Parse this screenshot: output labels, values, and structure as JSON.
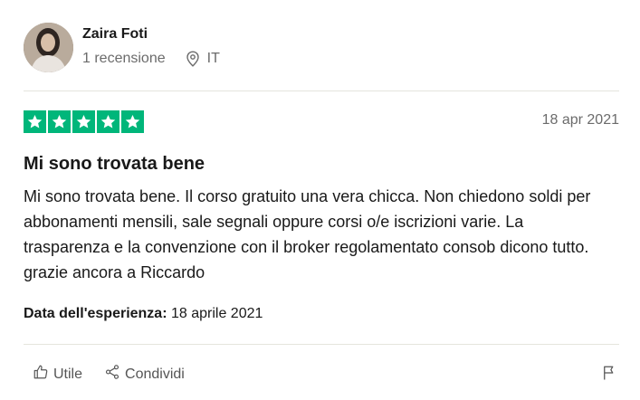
{
  "reviewer": {
    "name": "Zaira Foti",
    "reviews_count": "1 recensione",
    "country": "IT"
  },
  "review": {
    "rating": 5,
    "rating_color": "#00b67a",
    "date": "18 apr 2021",
    "title": "Mi sono trovata bene",
    "body": "Mi sono trovata bene. Il corso gratuito una vera chicca. Non chiedono soldi per abbonamenti mensili, sale segnali oppure corsi o/e iscrizioni varie. La trasparenza e la convenzione con il broker regolamentato consob dicono tutto. grazie ancora a Riccardo",
    "experience_label": "Data dell'esperienza:",
    "experience_date": "18 aprile 2021"
  },
  "actions": {
    "useful_label": "Utile",
    "share_label": "Condividi"
  },
  "icons": {
    "avatar": "reviewer-avatar",
    "location": "location-pin-icon",
    "star": "star-icon",
    "useful": "thumbs-up-icon",
    "share": "share-icon",
    "report": "flag-icon"
  }
}
